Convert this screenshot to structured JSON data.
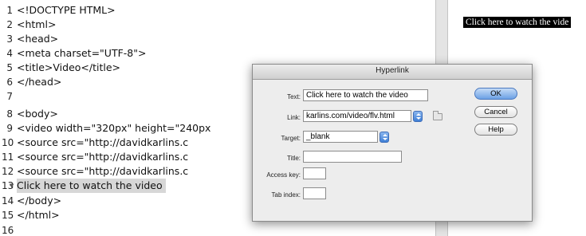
{
  "editor": {
    "lines": [
      {
        "num": "1",
        "text": "<!DOCTYPE HTML>"
      },
      {
        "num": "2",
        "text": "<html>"
      },
      {
        "num": "3",
        "text": "<head>"
      },
      {
        "num": "4",
        "text": "<meta charset=\"UTF-8\">"
      },
      {
        "num": "5",
        "text": "<title>Video</title>"
      },
      {
        "num": "6",
        "text": "</head>"
      },
      {
        "num": "7",
        "text": ""
      },
      {
        "num": "8",
        "text": "<body>"
      },
      {
        "num": "9",
        "text": "<video width=\"320px\" height=\"240px"
      },
      {
        "num": "10",
        "text": "<source src=\"http://davidkarlins.c"
      },
      {
        "num": "11",
        "text": "<source src=\"http://davidkarlins.c"
      },
      {
        "num": "12",
        "text": "<source src=\"http://davidkarlins.c"
      },
      {
        "num": "13",
        "text": "Click here to watch the video"
      },
      {
        "num": "14",
        "text": "</body>"
      },
      {
        "num": "15",
        "text": "</html>"
      },
      {
        "num": "16",
        "text": ""
      }
    ],
    "fold_marker": "▼"
  },
  "design_view": {
    "link_text": "Click here to watch the vide"
  },
  "dialog": {
    "title": "Hyperlink",
    "labels": {
      "text": "Text:",
      "link": "Link:",
      "target": "Target:",
      "title": "Title:",
      "access_key": "Access key:",
      "tab_index": "Tab index:"
    },
    "values": {
      "text": "Click here to watch the video",
      "link": "karlins.com/video/flv.html",
      "target": "_blank",
      "title": "",
      "access_key": "",
      "tab_index": ""
    },
    "buttons": {
      "ok": "OK",
      "cancel": "Cancel",
      "help": "Help"
    }
  }
}
